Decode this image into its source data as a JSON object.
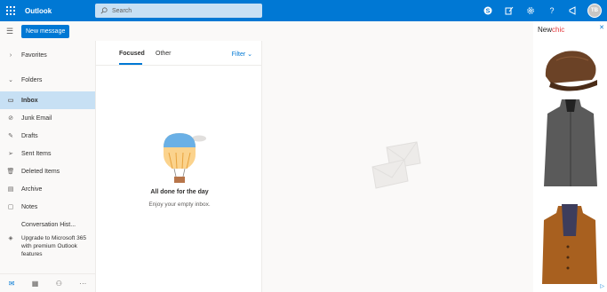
{
  "app": {
    "name": "Outlook"
  },
  "search": {
    "placeholder": "Search"
  },
  "topbar": {
    "avatar_initials": "TB",
    "icons": [
      "skype-icon",
      "feedback-icon",
      "settings-icon",
      "help-icon",
      "whats-new-icon"
    ]
  },
  "toolbar": {
    "new_message": "New message"
  },
  "sidebar": {
    "favorites": "Favorites",
    "folders": "Folders",
    "items": [
      {
        "label": "Inbox",
        "icon": "inbox-icon"
      },
      {
        "label": "Junk Email",
        "icon": "junk-icon"
      },
      {
        "label": "Drafts",
        "icon": "pencil-icon"
      },
      {
        "label": "Sent Items",
        "icon": "send-icon"
      },
      {
        "label": "Deleted Items",
        "icon": "trash-icon"
      },
      {
        "label": "Archive",
        "icon": "archive-icon"
      },
      {
        "label": "Notes",
        "icon": "note-icon"
      },
      {
        "label": "Conversation Hist...",
        "icon": ""
      }
    ],
    "upgrade": "Upgrade to Microsoft 365 with premium Outlook features"
  },
  "list": {
    "tabs": [
      "Focused",
      "Other"
    ],
    "filter": "Filter",
    "empty_title": "All done for the day",
    "empty_subtitle": "Enjoy your empty inbox."
  },
  "ad": {
    "brand_prefix": "New",
    "brand_suffix": "chic",
    "close": "✕",
    "info": "▷"
  },
  "colors": {
    "accent": "#0078d4",
    "selected": "#c7e0f4",
    "search_bg": "#c7e0f4"
  }
}
